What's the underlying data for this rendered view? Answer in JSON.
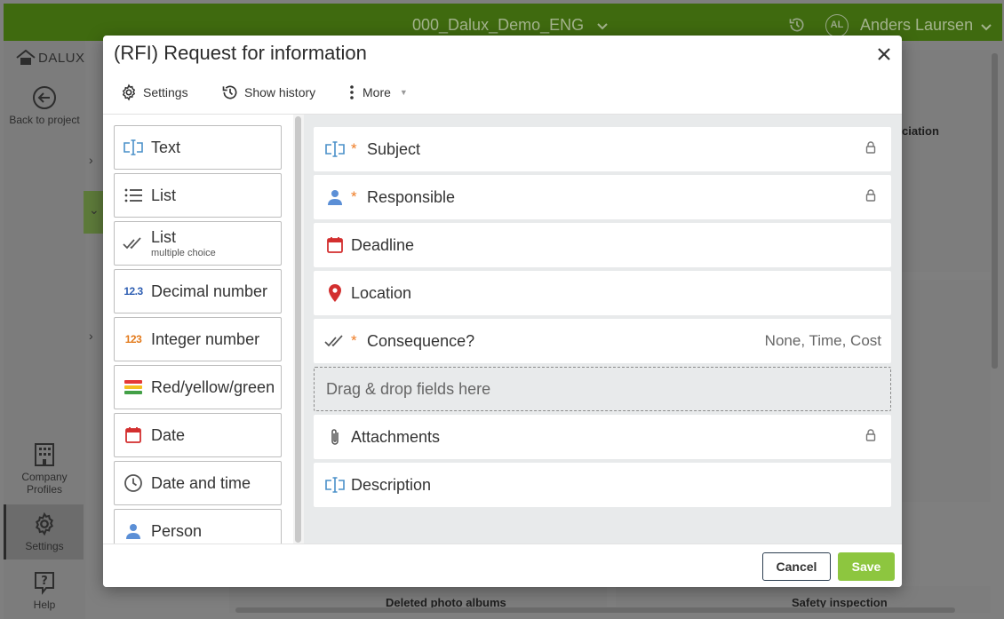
{
  "app": {
    "project_name": "000_Dalux_Demo_ENG",
    "user_initials": "AL",
    "user_name": "Anders Laursen",
    "logo_text": "DALUX"
  },
  "sidebar": {
    "back_label": "Back to project",
    "company_profiles_label": "Company Profiles",
    "settings_label": "Settings",
    "help_label": "Help"
  },
  "background": {
    "partial_text_1": "ciation",
    "tile_1_label": "Deleted photo albums",
    "tile_2_label": "Safety inspection"
  },
  "modal": {
    "title": "(RFI) Request for information",
    "toolbar": {
      "settings_label": "Settings",
      "history_label": "Show history",
      "more_label": "More"
    },
    "palette": [
      {
        "label": "Text",
        "icon": "text-field-icon"
      },
      {
        "label": "List",
        "icon": "list-icon"
      },
      {
        "label": "List",
        "sublabel": "multiple choice",
        "icon": "double-check-icon"
      },
      {
        "label": "Decimal number",
        "icon": "decimal-number-icon",
        "icon_text": "12.3"
      },
      {
        "label": "Integer number",
        "icon": "integer-number-icon",
        "icon_text": "123"
      },
      {
        "label": "Red/yellow/green",
        "icon": "traffic-light-icon"
      },
      {
        "label": "Date",
        "icon": "calendar-icon"
      },
      {
        "label": "Date and time",
        "icon": "clock-icon"
      },
      {
        "label": "Person",
        "icon": "person-icon"
      }
    ],
    "fields": [
      {
        "label": "Subject",
        "required": "*",
        "icon": "text-field-icon",
        "locked": true
      },
      {
        "label": "Responsible",
        "required": "*",
        "icon": "person-icon",
        "locked": true
      },
      {
        "label": "Deadline",
        "icon": "calendar-icon"
      },
      {
        "label": "Location",
        "icon": "location-pin-icon"
      },
      {
        "label": "Consequence?",
        "required": "*",
        "icon": "double-check-icon",
        "value": "None, Time, Cost"
      }
    ],
    "dropzone_text": "Drag & drop fields here",
    "fields_after": [
      {
        "label": "Attachments",
        "icon": "paperclip-icon",
        "locked": true
      },
      {
        "label": "Description",
        "icon": "text-field-icon"
      }
    ],
    "footer": {
      "cancel_label": "Cancel",
      "save_label": "Save"
    }
  },
  "colors": {
    "accent_green": "#8dc63f",
    "required_orange": "#ef7d26",
    "date_red": "#d32f2f",
    "person_blue": "#5b8fd6"
  }
}
